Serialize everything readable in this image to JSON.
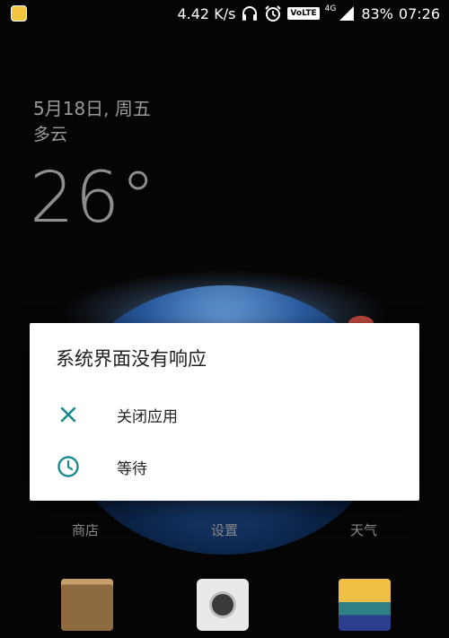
{
  "status_bar": {
    "net_speed": "4.42 K/s",
    "volte": "VoLTE",
    "network": "4G",
    "battery": "83%",
    "time": "07:26",
    "icons": [
      "app-notification-icon",
      "headphones-icon",
      "alarm-icon",
      "signal-icon"
    ]
  },
  "widget": {
    "date": "5月18日, 周五",
    "condition": "多云",
    "temperature": "26°"
  },
  "dialog": {
    "title": "系统界面没有响应",
    "options": [
      {
        "label": "关闭应用",
        "icon": "close-icon"
      },
      {
        "label": "等待",
        "icon": "clock-icon"
      }
    ],
    "accent": "#1a8a8c"
  },
  "dock": {
    "labels": [
      "商店",
      "设置",
      "天气"
    ],
    "apps": [
      "files-app-icon",
      "camera-app-icon",
      "gallery-app-icon"
    ]
  }
}
